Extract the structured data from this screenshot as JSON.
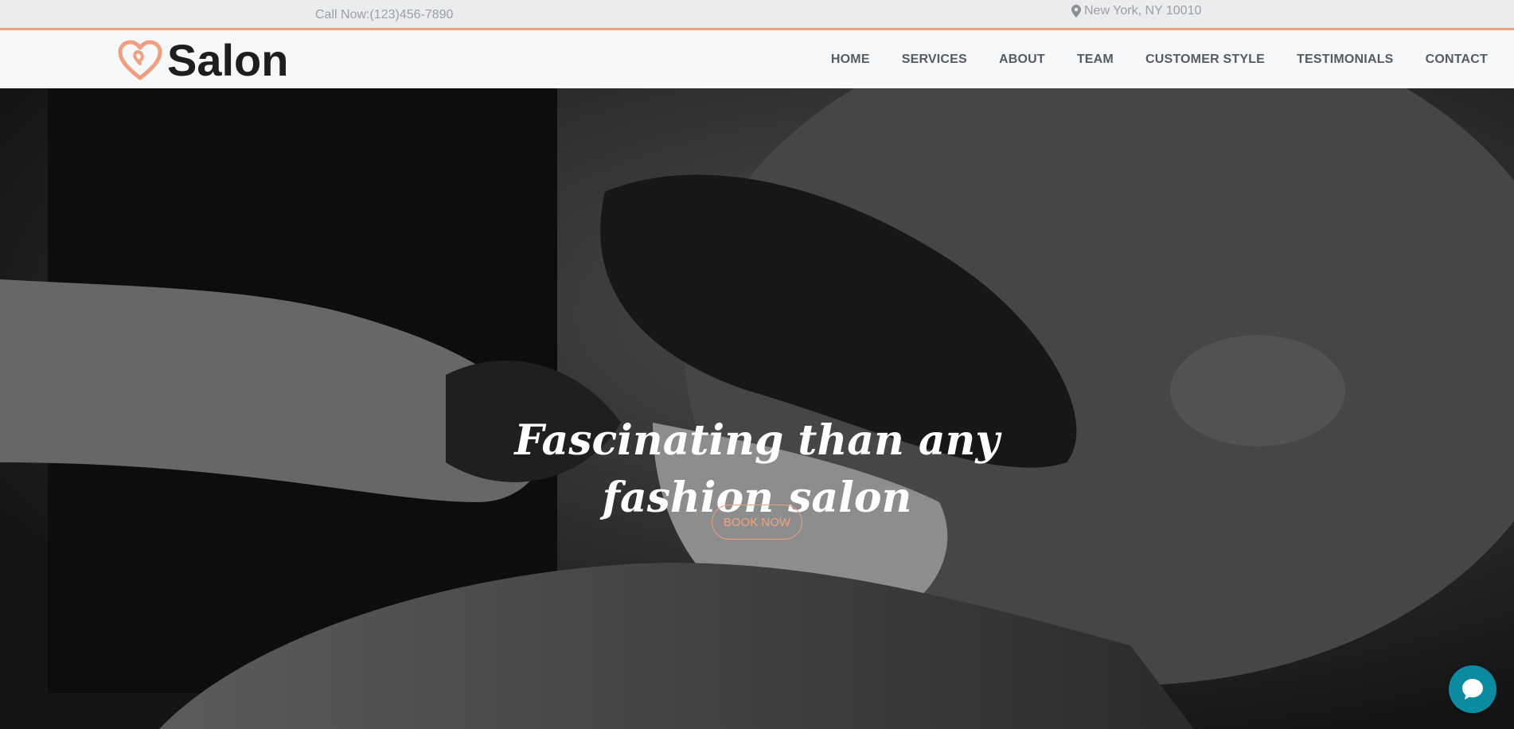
{
  "topbar": {
    "phone": "Call Now:(123)456-7890",
    "location_icon": "map-pin-icon",
    "location": "New York, NY 10010"
  },
  "brand": {
    "logo_icon": "heart-icon",
    "name": "Salon",
    "accent_color": "#f0a080"
  },
  "nav": {
    "items": [
      {
        "label": "HOME"
      },
      {
        "label": "SERVICES"
      },
      {
        "label": "ABOUT"
      },
      {
        "label": "TEAM"
      },
      {
        "label": "CUSTOMER STYLE"
      },
      {
        "label": "TESTIMONIALS"
      },
      {
        "label": "CONTACT"
      }
    ]
  },
  "hero": {
    "title_line1": "Fascinating than any",
    "title_line2": "fashion salon",
    "cta_label": "BOOK NOW"
  },
  "chat": {
    "icon": "chat-bubble-icon",
    "color": "#0b8aa0"
  }
}
